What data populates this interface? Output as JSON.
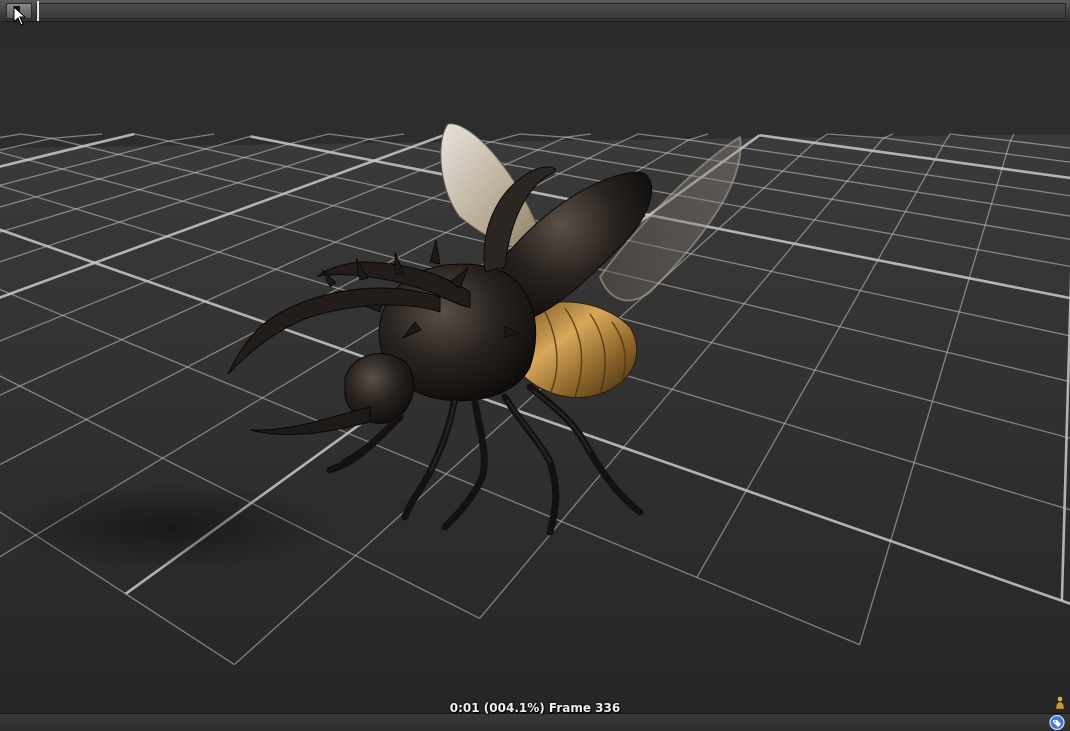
{
  "timeline": {
    "play_icon": "play-pause-icon",
    "cursor_icon": "mouse-pointer-icon"
  },
  "viewport": {
    "scene_subject": "3d-beetle-model",
    "grid_color": "#c9c9c9",
    "floor_color": "#2b2b2b",
    "background_color": "#2e2e2e"
  },
  "status": {
    "frame_text": "0:01 (004.1%) Frame 336"
  },
  "footer": {
    "figure_icon": "figure-icon",
    "tag_icon": "tag-icon"
  }
}
